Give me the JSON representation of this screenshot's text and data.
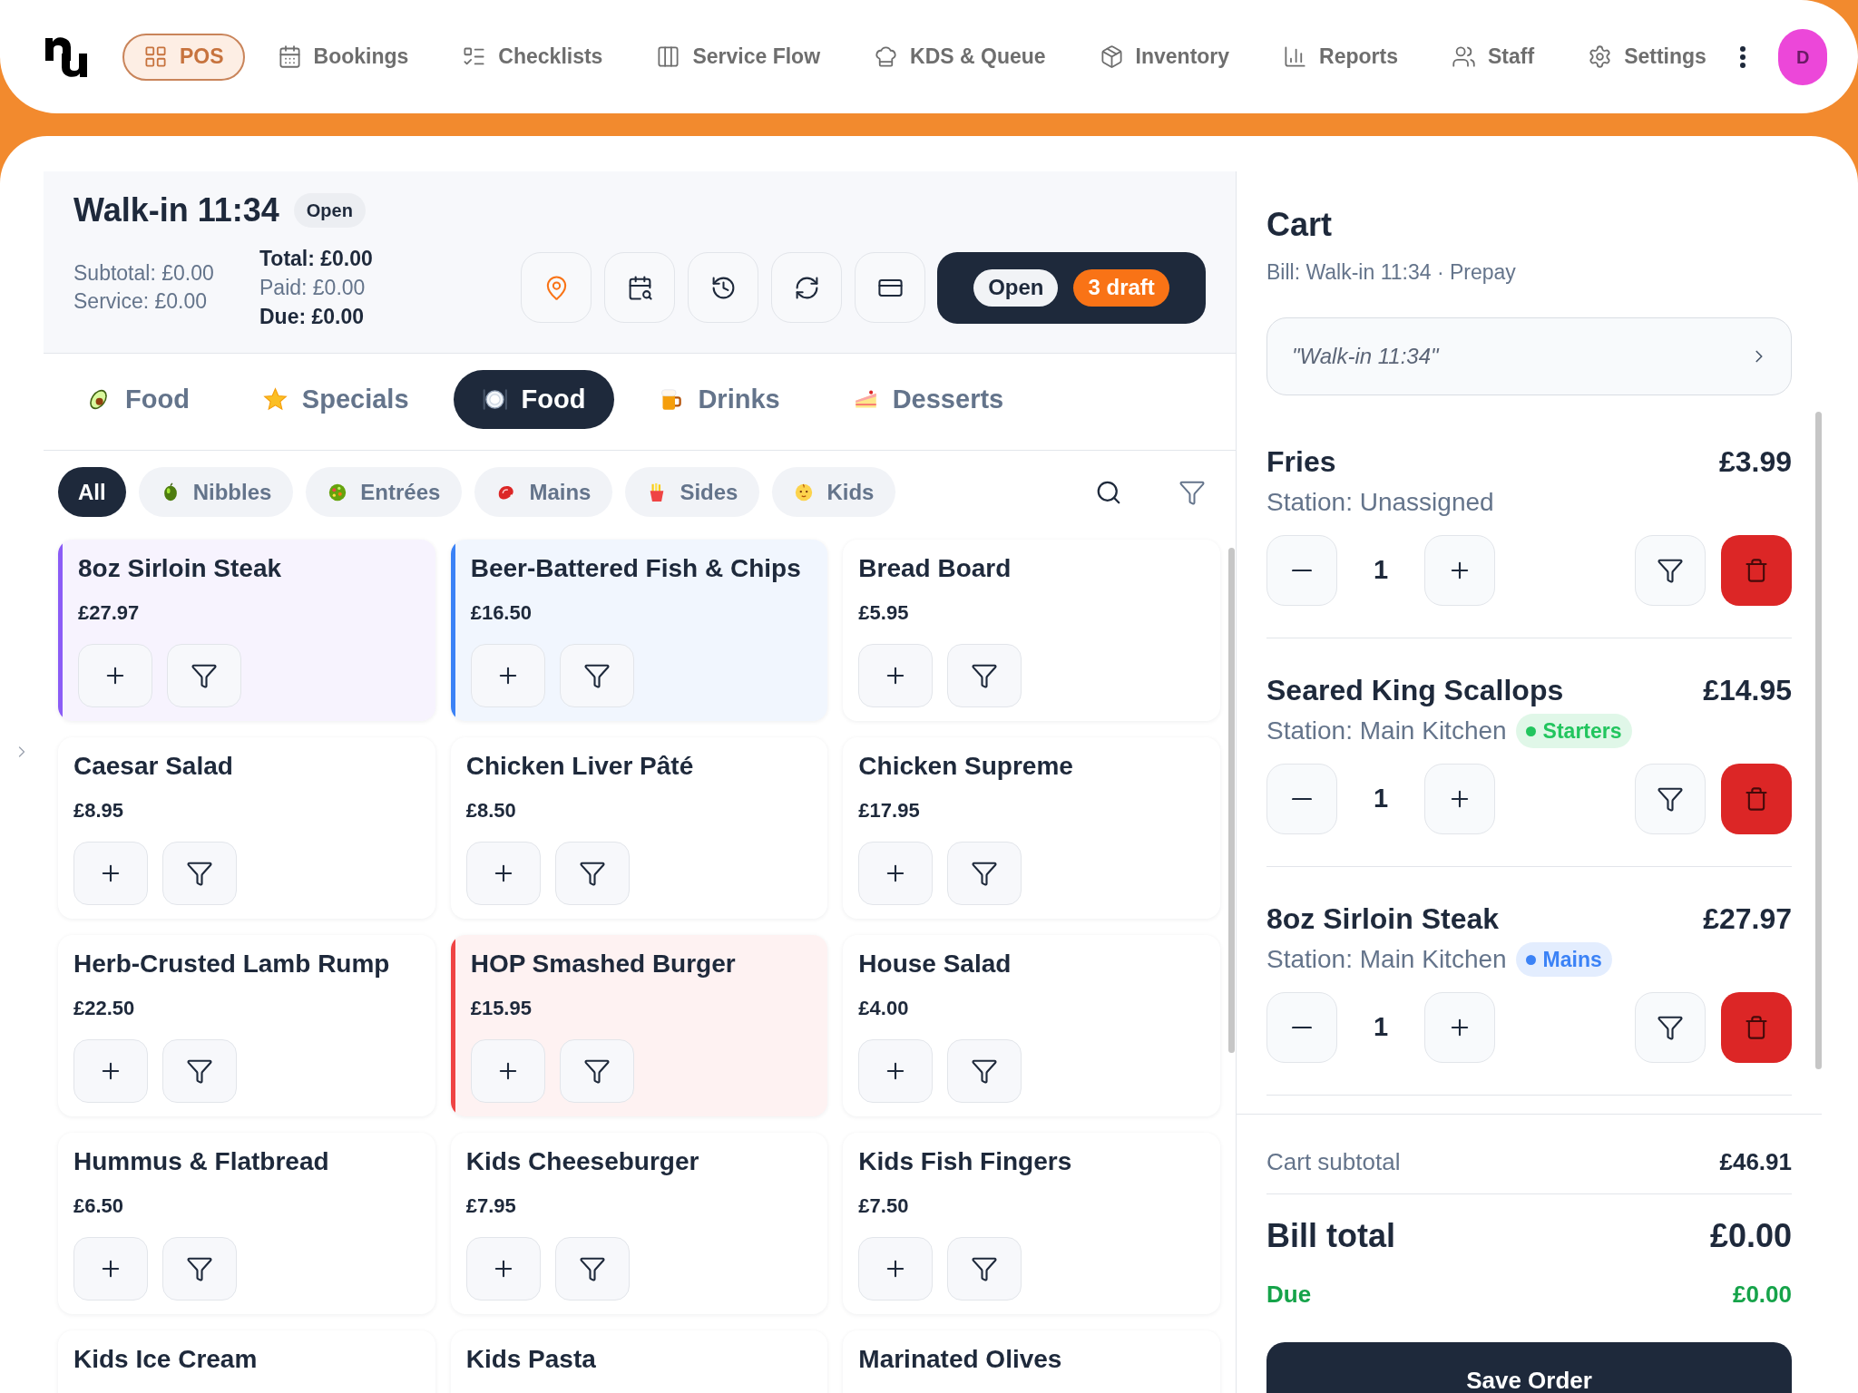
{
  "top_bar": {
    "nav_items": [
      {
        "label": "POS",
        "selected": true
      },
      {
        "label": "Bookings",
        "selected": false
      },
      {
        "label": "Checklists",
        "selected": false
      },
      {
        "label": "Service Flow",
        "selected": false
      },
      {
        "label": "KDS & Queue",
        "selected": false
      },
      {
        "label": "Inventory",
        "selected": false
      },
      {
        "label": "Reports",
        "selected": false
      },
      {
        "label": "Staff",
        "selected": false
      },
      {
        "label": "Settings",
        "selected": false
      }
    ],
    "avatar": "D"
  },
  "bill": {
    "title": "Walk-in 11:34",
    "status": "Open",
    "breakdown": [
      "Subtotal: £0.00",
      "Service: £0.00"
    ],
    "totals": [
      {
        "text": "Total: £0.00",
        "emphasis": true
      },
      {
        "text": "Paid: £0.00",
        "emphasis": false
      },
      {
        "text": "Due: £0.00",
        "emphasis": true
      }
    ],
    "order_status": "Open",
    "drafts": "3 draft"
  },
  "category_tabs": [
    {
      "label": "Food",
      "selected": false
    },
    {
      "label": "Specials",
      "selected": false
    },
    {
      "label": "Food",
      "selected": true
    },
    {
      "label": "Drinks",
      "selected": false
    },
    {
      "label": "Desserts",
      "selected": false
    }
  ],
  "subcategories": [
    {
      "label": "All",
      "selected": true
    },
    {
      "label": "Nibbles",
      "selected": false
    },
    {
      "label": "Entrées",
      "selected": false
    },
    {
      "label": "Mains",
      "selected": false
    },
    {
      "label": "Sides",
      "selected": false
    },
    {
      "label": "Kids",
      "selected": false
    }
  ],
  "products": [
    {
      "name": "8oz Sirloin Steak",
      "price": "£27.97",
      "color": "#8b5cf6"
    },
    {
      "name": "Beer-Battered Fish & Chips",
      "price": "£16.50",
      "color": "#3b82f6"
    },
    {
      "name": "Bread Board",
      "price": "£5.95"
    },
    {
      "name": "Caesar Salad",
      "price": "£8.95"
    },
    {
      "name": "Chicken Liver Pâté",
      "price": "£8.50"
    },
    {
      "name": "Chicken Supreme",
      "price": "£17.95"
    },
    {
      "name": "Herb-Crusted Lamb Rump",
      "price": "£22.50"
    },
    {
      "name": "HOP Smashed Burger",
      "price": "£15.95",
      "color": "#ef4444"
    },
    {
      "name": "House Salad",
      "price": "£4.00"
    },
    {
      "name": "Hummus & Flatbread",
      "price": "£6.50"
    },
    {
      "name": "Kids Cheeseburger",
      "price": "£7.95"
    },
    {
      "name": "Kids Fish Fingers",
      "price": "£7.50"
    },
    {
      "name": "Kids Ice Cream"
    },
    {
      "name": "Kids Pasta"
    },
    {
      "name": "Marinated Olives"
    }
  ],
  "cart": {
    "title": "Cart",
    "subtitle": "Bill: Walk-in 11:34 · Prepay",
    "bill_name": "\"Walk-in 11:34\"",
    "items": [
      {
        "name": "Fries",
        "price": "£3.99",
        "station": "Station: Unassigned",
        "quantity": "1"
      },
      {
        "name": "Seared King Scallops",
        "price": "£14.95",
        "station": "Station: Main Kitchen",
        "tag": {
          "label": "Starters",
          "color": "#22c55e"
        },
        "quantity": "1"
      },
      {
        "name": "8oz Sirloin Steak",
        "price": "£27.97",
        "station": "Station: Main Kitchen",
        "tag": {
          "label": "Mains",
          "color": "#3b82f6"
        },
        "quantity": "1"
      }
    ],
    "summary": {
      "subtotal_label": "Cart subtotal",
      "subtotal": "£46.91",
      "total_label": "Bill total",
      "total": "£0.00",
      "due_label": "Due",
      "due": "£0.00"
    },
    "save_button": "Save Order"
  }
}
